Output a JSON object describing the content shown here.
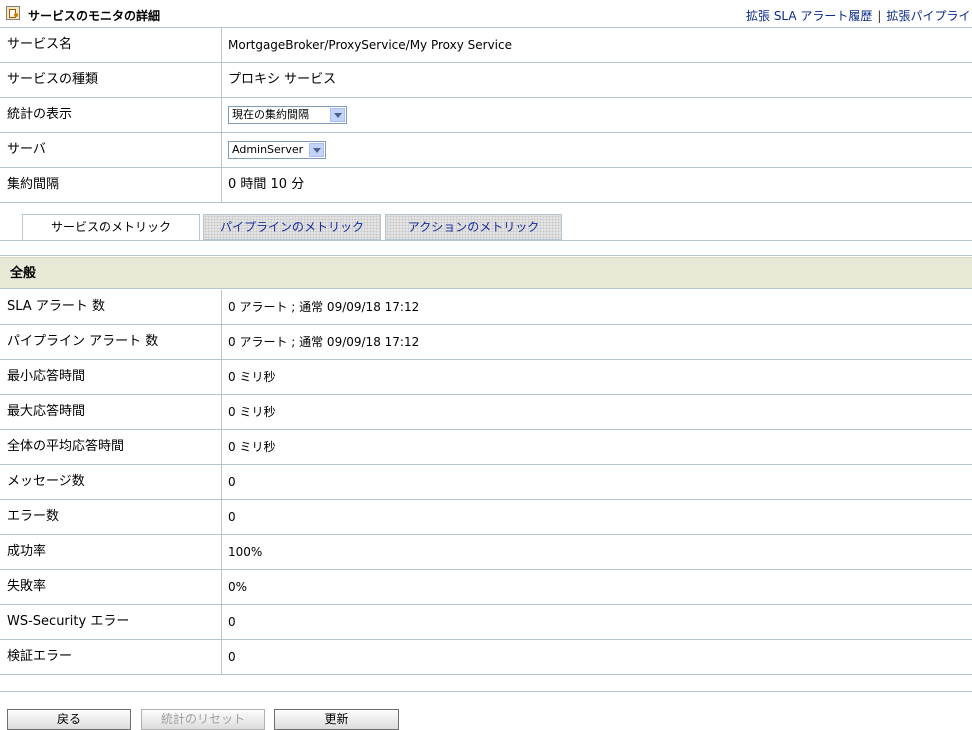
{
  "header": {
    "title": "サービスのモニタの詳細",
    "links": [
      "拡張 SLA アラート履歴",
      "拡張パイプライン アラ"
    ]
  },
  "info_rows": [
    {
      "label": "サービス名",
      "value": "MortgageBroker/ProxyService/My Proxy Service"
    },
    {
      "label": "サービスの種類",
      "value": "プロキシ サービス"
    },
    {
      "label": "統計の表示",
      "select_value": "現在の集約間隔"
    },
    {
      "label": "サーバ",
      "select_value": "AdminServer"
    },
    {
      "label": "集約間隔",
      "value": "0 時間 10 分"
    }
  ],
  "tabs": [
    {
      "label": "サービスのメトリック",
      "active": true
    },
    {
      "label": "パイプラインのメトリック",
      "active": false
    },
    {
      "label": "アクションのメトリック",
      "active": false
    }
  ],
  "section": {
    "title": "全般"
  },
  "metrics": [
    {
      "label": "SLA アラート 数",
      "value": "0 アラート ; 通常 09/09/18 17:12"
    },
    {
      "label": "パイプライン アラート 数",
      "value": "0 アラート ; 通常 09/09/18 17:12"
    },
    {
      "label": "最小応答時間",
      "value": "0 ミリ秒"
    },
    {
      "label": "最大応答時間",
      "value": "0 ミリ秒"
    },
    {
      "label": "全体の平均応答時間",
      "value": "0 ミリ秒"
    },
    {
      "label": "メッセージ数",
      "value": "0"
    },
    {
      "label": "エラー数",
      "value": "0"
    },
    {
      "label": "成功率",
      "value": "100%"
    },
    {
      "label": "失敗率",
      "value": "0%"
    },
    {
      "label": "WS-Security エラー",
      "value": "0"
    },
    {
      "label": "検証エラー",
      "value": "0"
    }
  ],
  "buttons": {
    "back": "戻る",
    "reset": "統計のリセット",
    "refresh": "更新"
  }
}
